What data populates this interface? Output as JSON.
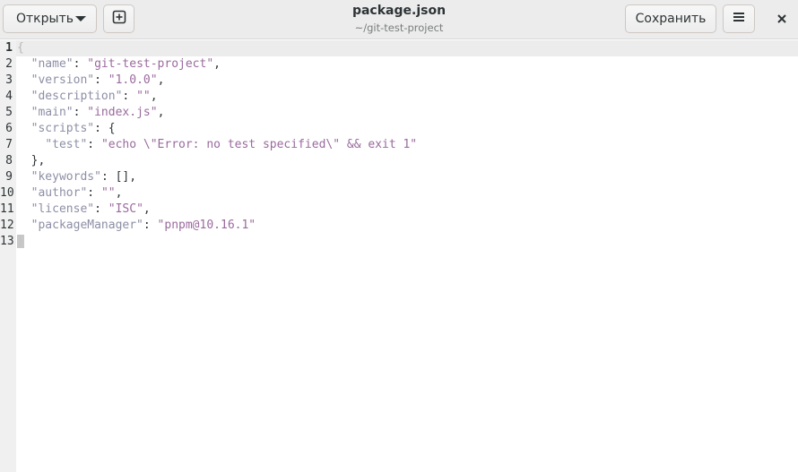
{
  "header": {
    "open_label": "Открыть",
    "save_label": "Сохранить",
    "title": "package.json",
    "subtitle": "~/git-test-project"
  },
  "icons": {
    "open_dropdown": "chevron-down-icon",
    "new_tab": "new-tab-icon",
    "menu": "hamburger-menu-icon",
    "close": "close-icon"
  },
  "editor": {
    "current_line": 1,
    "lines": [
      {
        "num": "1",
        "indent": "",
        "key": "",
        "sep": "",
        "value": "",
        "tail": "{"
      },
      {
        "num": "2",
        "indent": "  ",
        "key": "\"name\"",
        "sep": ": ",
        "value": "\"git-test-project\"",
        "tail": ","
      },
      {
        "num": "3",
        "indent": "  ",
        "key": "\"version\"",
        "sep": ": ",
        "value": "\"1.0.0\"",
        "tail": ","
      },
      {
        "num": "4",
        "indent": "  ",
        "key": "\"description\"",
        "sep": ": ",
        "value": "\"\"",
        "tail": ","
      },
      {
        "num": "5",
        "indent": "  ",
        "key": "\"main\"",
        "sep": ": ",
        "value": "\"index.js\"",
        "tail": ","
      },
      {
        "num": "6",
        "indent": "  ",
        "key": "\"scripts\"",
        "sep": ": ",
        "value": "",
        "tail": "{"
      },
      {
        "num": "7",
        "indent": "    ",
        "key": "\"test\"",
        "sep": ": ",
        "value": "\"echo \\\"Error: no test specified\\\" && exit 1\"",
        "tail": ""
      },
      {
        "num": "8",
        "indent": "  ",
        "key": "",
        "sep": "",
        "value": "",
        "tail": "},"
      },
      {
        "num": "9",
        "indent": "  ",
        "key": "\"keywords\"",
        "sep": ": ",
        "value": "",
        "tail": "[],"
      },
      {
        "num": "10",
        "indent": "  ",
        "key": "\"author\"",
        "sep": ": ",
        "value": "\"\"",
        "tail": ","
      },
      {
        "num": "11",
        "indent": "  ",
        "key": "\"license\"",
        "sep": ": ",
        "value": "\"ISC\"",
        "tail": ","
      },
      {
        "num": "12",
        "indent": "  ",
        "key": "\"packageManager\"",
        "sep": ": ",
        "value": "\"pnpm@10.16.1\"",
        "tail": ""
      },
      {
        "num": "13",
        "indent": "",
        "key": "",
        "sep": "",
        "value": "",
        "tail": "}"
      }
    ]
  },
  "colors": {
    "key": "#8d8fa5",
    "string": "#9a6a9e",
    "text": "#2e3436",
    "gutter": "#f0f0f0",
    "header_bg": "#ececec"
  }
}
